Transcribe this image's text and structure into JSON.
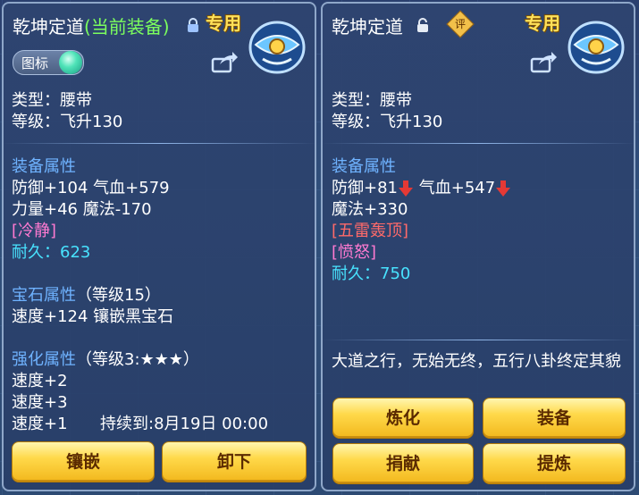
{
  "left_panel": {
    "title_name": "乾坤定道",
    "title_status": "(当前装备)",
    "exclusive": "专用",
    "toggle_label": "图标",
    "type_line": "类型：腰带",
    "level_line": "等级：飞升130",
    "equip_attr_header": "装备属性",
    "attr_line1": "防御+104 气血+579",
    "attr_line2": "力量+46 魔法-170",
    "special_tag": "[冷静]",
    "durability_label": "耐久：",
    "durability_value": "623",
    "gem_header": "宝石属性",
    "gem_level": "（等级15）",
    "gem_line": "速度+124 镶嵌黑宝石",
    "enhance_header": "强化属性",
    "enhance_level": "（等级3:★★★）",
    "enhance_line1": "速度+2",
    "enhance_line2": "速度+3",
    "enhance_line3": "速度+1",
    "enhance_duration": "持续到:8月19日 00:00",
    "buttons": [
      "镶嵌",
      "卸下"
    ]
  },
  "right_panel": {
    "title_name": "乾坤定道",
    "exclusive": "专用",
    "rate_badge": "评",
    "type_line": "类型：腰带",
    "level_line": "等级：飞升130",
    "equip_attr_header": "装备属性",
    "attr_def": "防御+81",
    "attr_hp": "气血+547",
    "attr_mp": "魔法+330",
    "special_tag1": "[五雷轰顶]",
    "special_tag2": "[愤怒]",
    "durability_label": "耐久：",
    "durability_value": "750",
    "description": "大道之行，无始无终，五行八卦终定其貌",
    "buttons": [
      "炼化",
      "装备",
      "捐献",
      "提炼"
    ]
  },
  "colors": {
    "header_blue": "#6fb3ff",
    "cyan": "#48e3ff",
    "pink_tag": "#ff7ad1",
    "red_tag": "#ff6a6a",
    "current_green": "#7cff5e",
    "exclusive_gold": "#ffe15a",
    "decrease_arrow": "#e53935"
  },
  "icons": [
    "lock-closed-icon",
    "lock-open-icon",
    "share-icon",
    "belt-item-icon",
    "decrease-arrow-icon",
    "rate-badge-icon"
  ]
}
